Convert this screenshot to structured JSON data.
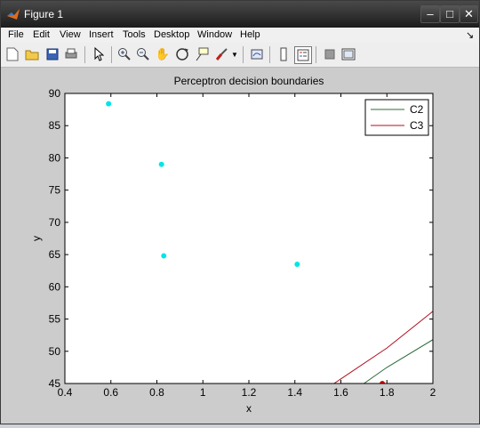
{
  "window": {
    "title": "Figure 1",
    "minimize_icon": "minimize-icon",
    "maximize_icon": "maximize-icon",
    "close_icon": "close-icon"
  },
  "menu": {
    "items": [
      "File",
      "Edit",
      "View",
      "Insert",
      "Tools",
      "Desktop",
      "Window",
      "Help"
    ],
    "dock_arrow": "↘"
  },
  "toolbar": {
    "icons": [
      "new-figure-icon",
      "open-file-icon",
      "save-icon",
      "print-icon",
      "pointer-icon",
      "zoom-in-icon",
      "zoom-out-icon",
      "pan-icon",
      "rotate-3d-icon",
      "data-cursor-icon",
      "brush-icon",
      "brush-dropdown-icon",
      "link-plot-icon",
      "colorbar-icon",
      "legend-icon",
      "hide-plot-tools-icon",
      "show-plot-tools-icon"
    ]
  },
  "chart_data": {
    "type": "scatter",
    "title": "Perceptron decision boundaries",
    "xlabel": "x",
    "ylabel": "y",
    "xlim": [
      0.4,
      2
    ],
    "ylim": [
      45,
      90
    ],
    "xticks": [
      "0.4",
      "0.6",
      "0.8",
      "1",
      "1.2",
      "1.4",
      "1.6",
      "1.8",
      "2"
    ],
    "yticks": [
      "45",
      "50",
      "55",
      "60",
      "65",
      "70",
      "75",
      "80",
      "85",
      "90"
    ],
    "points": {
      "cyan": {
        "color": "#00e5e5",
        "x": [
          0.59,
          0.82,
          0.83,
          1.41
        ],
        "y": [
          88.4,
          79.0,
          64.8,
          63.5
        ]
      },
      "red": {
        "color": "#e00000",
        "x": [
          1.78
        ],
        "y": [
          45.0
        ]
      }
    },
    "series": [
      {
        "name": "C2",
        "color": "#2e6b3c",
        "type": "line",
        "x": [
          1.7,
          1.8,
          2.0
        ],
        "y": [
          45.0,
          47.5,
          51.8
        ]
      },
      {
        "name": "C3",
        "color": "#b01020",
        "type": "line",
        "x": [
          1.57,
          1.8,
          2.0
        ],
        "y": [
          45.0,
          50.5,
          56.2
        ]
      }
    ],
    "legend_position": "top-right",
    "grid": false
  }
}
